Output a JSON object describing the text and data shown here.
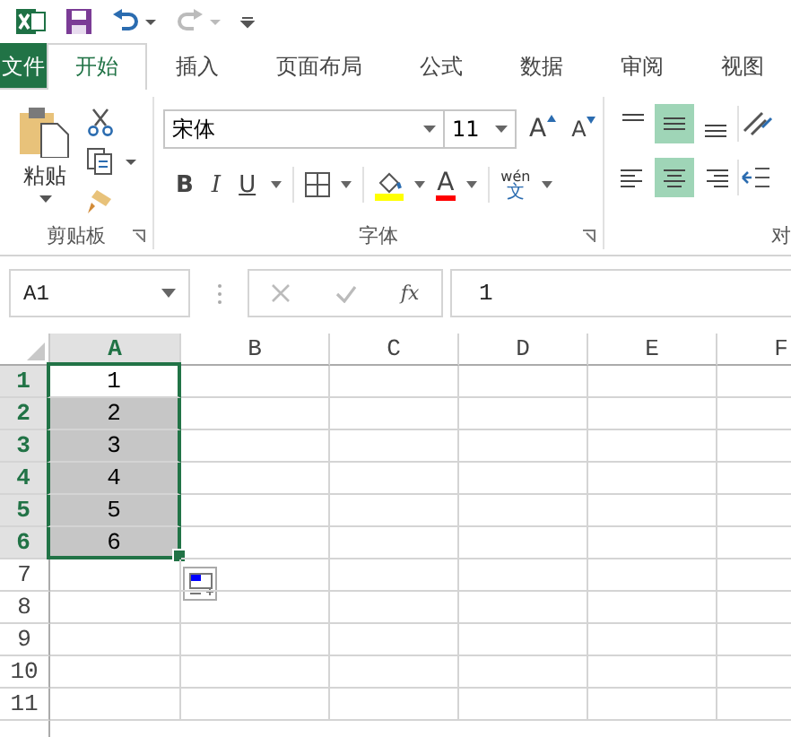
{
  "tabs": [
    {
      "label": "文件",
      "kind": "file",
      "selected": false
    },
    {
      "label": "开始",
      "kind": "tab",
      "selected": true
    },
    {
      "label": "插入",
      "kind": "tab",
      "selected": false
    },
    {
      "label": "页面布局",
      "kind": "tab",
      "selected": false
    },
    {
      "label": "公式",
      "kind": "tab",
      "selected": false
    },
    {
      "label": "数据",
      "kind": "tab",
      "selected": false
    },
    {
      "label": "审阅",
      "kind": "tab",
      "selected": false
    },
    {
      "label": "视图",
      "kind": "tab",
      "selected": false
    }
  ],
  "clipboard": {
    "paste_label": "粘贴",
    "label": "剪贴板"
  },
  "font": {
    "font_name": "宋体",
    "font_size": "11",
    "grow_glyph": "A",
    "shrink_glyph": "A",
    "bold": "B",
    "italic": "I",
    "underline": "U",
    "font_color_glyph": "A",
    "phonetic_top": "wén",
    "phonetic_bottom": "文",
    "label": "字体"
  },
  "alignment": {
    "vertical": [
      {
        "kind": "top",
        "selected": false
      },
      {
        "kind": "middle",
        "selected": true
      },
      {
        "kind": "bottom",
        "selected": false
      }
    ],
    "horizontal": [
      {
        "kind": "left",
        "selected": false
      },
      {
        "kind": "center",
        "selected": true
      },
      {
        "kind": "right",
        "selected": false
      }
    ],
    "label": "对"
  },
  "formula_bar": {
    "name_box": "A1",
    "fx": "fx",
    "value": "1"
  },
  "sheet": {
    "columns": [
      {
        "label": "A",
        "selected": true
      },
      {
        "label": "B",
        "selected": false
      },
      {
        "label": "C",
        "selected": false
      },
      {
        "label": "D",
        "selected": false
      },
      {
        "label": "E",
        "selected": false
      },
      {
        "label": "F",
        "selected": false
      }
    ],
    "rows": [
      {
        "label": "1",
        "selected": true,
        "active": true,
        "value": "1"
      },
      {
        "label": "2",
        "selected": true,
        "active": false,
        "value": "2"
      },
      {
        "label": "3",
        "selected": true,
        "active": false,
        "value": "3"
      },
      {
        "label": "4",
        "selected": true,
        "active": false,
        "value": "4"
      },
      {
        "label": "5",
        "selected": true,
        "active": false,
        "value": "5"
      },
      {
        "label": "6",
        "selected": true,
        "active": false,
        "value": "6"
      },
      {
        "label": "7",
        "selected": false,
        "active": false,
        "value": ""
      },
      {
        "label": "8",
        "selected": false,
        "active": false,
        "value": ""
      },
      {
        "label": "9",
        "selected": false,
        "active": false,
        "value": ""
      },
      {
        "label": "10",
        "selected": false,
        "active": false,
        "value": ""
      },
      {
        "label": "11",
        "selected": false,
        "active": false,
        "value": ""
      }
    ]
  }
}
